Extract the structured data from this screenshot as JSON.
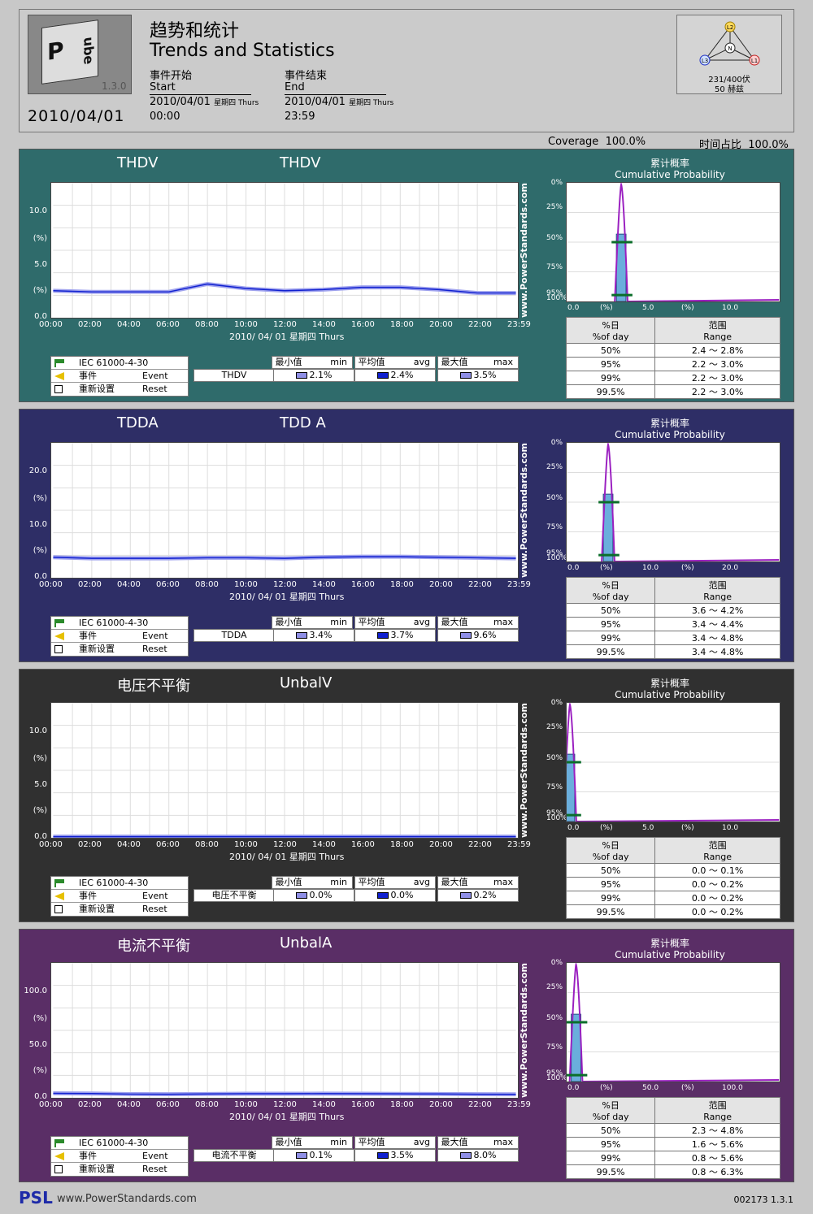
{
  "header": {
    "title_cn": "趋势和统计",
    "title_en": "Trends and Statistics",
    "logo_version": "1.3.0",
    "date": "2010/04/01",
    "start_cn": "事件开始",
    "start_en": "Start",
    "start_date": "2010/04/01",
    "start_day": "星期四 Thurs",
    "start_time": "00:00",
    "end_cn": "事件结束",
    "end_en": "End",
    "end_date": "2010/04/01",
    "end_day": "星期四 Thurs",
    "end_time": "23:59",
    "phase_voltage": "231/400伏",
    "phase_freq": "50 赫兹",
    "phase_labels": [
      "L2",
      "N",
      "L3",
      "L1"
    ]
  },
  "coverage": {
    "en_label": "Coverage",
    "en_value": "100.0%",
    "cn_label": "时间占比",
    "cn_value": "100.0%"
  },
  "common": {
    "x_ticks": [
      "00:00",
      "02:00",
      "04:00",
      "06:00",
      "08:00",
      "10:00",
      "12:00",
      "14:00",
      "16:00",
      "18:00",
      "20:00",
      "22:00",
      "23:59"
    ],
    "x_date": "2010/ 04/ 01 星期四 Thurs",
    "watermark": "www.PowerStandards.com",
    "cum_cn": "累计概率",
    "cum_en": "Cumulative Probability",
    "cum_y": [
      "0%",
      "25%",
      "50%",
      "75%",
      "95%",
      "100%"
    ],
    "pct_day_cn": "%日",
    "pct_day_en": "%of day",
    "range_cn": "范围",
    "range_en": "Range",
    "legend_std": "IEC 61000-4-30",
    "legend_event_cn": "事件",
    "legend_event_en": "Event",
    "legend_reset_cn": "重新设置",
    "legend_reset_en": "Reset",
    "min_cn": "最小值",
    "min_en": "min",
    "avg_cn": "平均值",
    "avg_en": "avg",
    "max_cn": "最大值",
    "max_en": "max",
    "pct_unit": "(%)"
  },
  "panels": [
    {
      "id": "thdv",
      "bg": "#2f6b6b",
      "title_left": "THDV",
      "title_right": "THDV",
      "y_ticks": [
        "10.0",
        "(%)",
        "5.0",
        "(%)",
        "0.0"
      ],
      "x_cum": [
        "0.0",
        "(%)",
        "5.0",
        "(%)",
        "10.0"
      ],
      "stat_label": "THDV",
      "min": "2.1%",
      "avg": "2.4%",
      "max": "3.5%",
      "rows": [
        [
          "50%",
          "2.4 ～ 2.8%"
        ],
        [
          "95%",
          "2.2 ～ 3.0%"
        ],
        [
          "99%",
          "2.2 ～ 3.0%"
        ],
        [
          "99.5%",
          "2.2 ～ 3.0%"
        ]
      ]
    },
    {
      "id": "tdda",
      "bg": "#2e2e66",
      "title_left": "TDDA",
      "title_right": "TDD A",
      "y_ticks": [
        "20.0",
        "(%)",
        "10.0",
        "(%)",
        "0.0"
      ],
      "x_cum": [
        "0.0",
        "(%)",
        "10.0",
        "(%)",
        "20.0"
      ],
      "stat_label": "TDDA",
      "min": "3.4%",
      "avg": "3.7%",
      "max": "9.6%",
      "rows": [
        [
          "50%",
          "3.6 ～ 4.2%"
        ],
        [
          "95%",
          "3.4 ～ 4.4%"
        ],
        [
          "99%",
          "3.4 ～ 4.8%"
        ],
        [
          "99.5%",
          "3.4 ～ 4.8%"
        ]
      ]
    },
    {
      "id": "unbv",
      "bg": "#303030",
      "title_left": "电压不平衡",
      "title_right": "UnbalV",
      "y_ticks": [
        "10.0",
        "(%)",
        "5.0",
        "(%)",
        "0.0"
      ],
      "x_cum": [
        "0.0",
        "(%)",
        "5.0",
        "(%)",
        "10.0"
      ],
      "stat_label": "电压不平衡",
      "min": "0.0%",
      "avg": "0.0%",
      "max": "0.2%",
      "rows": [
        [
          "50%",
          "0.0 ～ 0.1%"
        ],
        [
          "95%",
          "0.0 ～ 0.2%"
        ],
        [
          "99%",
          "0.0 ～ 0.2%"
        ],
        [
          "99.5%",
          "0.0 ～ 0.2%"
        ]
      ]
    },
    {
      "id": "unba",
      "bg": "#5a2e66",
      "title_left": "电流不平衡",
      "title_right": "UnbalA",
      "y_ticks": [
        "100.0",
        "(%)",
        "50.0",
        "(%)",
        "0.0"
      ],
      "x_cum": [
        "0.0",
        "(%)",
        "50.0",
        "(%)",
        "100.0"
      ],
      "stat_label": "电流不平衡",
      "min": "0.1%",
      "avg": "3.5%",
      "max": "8.0%",
      "rows": [
        [
          "50%",
          "2.3 ～ 4.8%"
        ],
        [
          "95%",
          "1.6 ～ 5.6%"
        ],
        [
          "99%",
          "0.8 ～ 5.6%"
        ],
        [
          "99.5%",
          "0.8 ～ 6.3%"
        ]
      ]
    }
  ],
  "chart_data": [
    {
      "type": "line",
      "title": "THDV",
      "x": [
        "00:00",
        "02:00",
        "04:00",
        "06:00",
        "08:00",
        "10:00",
        "12:00",
        "14:00",
        "16:00",
        "18:00",
        "20:00",
        "22:00",
        "23:59"
      ],
      "series": [
        {
          "values": [
            2.4,
            2.3,
            2.3,
            2.3,
            3.0,
            2.6,
            2.4,
            2.5,
            2.7,
            2.7,
            2.5,
            2.2,
            2.2
          ]
        }
      ],
      "ylim": [
        0,
        12
      ]
    },
    {
      "type": "line",
      "title": "TDDA",
      "x": [
        "00:00",
        "02:00",
        "04:00",
        "06:00",
        "08:00",
        "10:00",
        "12:00",
        "14:00",
        "16:00",
        "18:00",
        "20:00",
        "22:00",
        "23:59"
      ],
      "series": [
        {
          "values": [
            3.8,
            3.6,
            3.6,
            3.6,
            3.7,
            3.7,
            3.6,
            3.8,
            3.9,
            3.9,
            3.8,
            3.7,
            3.6
          ]
        }
      ],
      "ylim": [
        0,
        25
      ]
    },
    {
      "type": "line",
      "title": "UnbalV",
      "x": [
        "00:00",
        "02:00",
        "04:00",
        "06:00",
        "08:00",
        "10:00",
        "12:00",
        "14:00",
        "16:00",
        "18:00",
        "20:00",
        "22:00",
        "23:59"
      ],
      "series": [
        {
          "values": [
            0.1,
            0.1,
            0.1,
            0.1,
            0.1,
            0.1,
            0.1,
            0.1,
            0.1,
            0.1,
            0.1,
            0.1,
            0.1
          ]
        }
      ],
      "ylim": [
        0,
        12
      ]
    },
    {
      "type": "line",
      "title": "UnbalA",
      "x": [
        "00:00",
        "02:00",
        "04:00",
        "06:00",
        "08:00",
        "10:00",
        "12:00",
        "14:00",
        "16:00",
        "18:00",
        "20:00",
        "22:00",
        "23:59"
      ],
      "series": [
        {
          "values": [
            4.0,
            3.8,
            3.3,
            3.2,
            3.4,
            3.6,
            3.6,
            3.7,
            3.6,
            3.5,
            3.4,
            3.2,
            3.1
          ]
        }
      ],
      "ylim": [
        0,
        120
      ]
    }
  ],
  "footer": {
    "brand": "PSL",
    "url": "www.PowerStandards.com",
    "id": "002173  1.3.1"
  }
}
